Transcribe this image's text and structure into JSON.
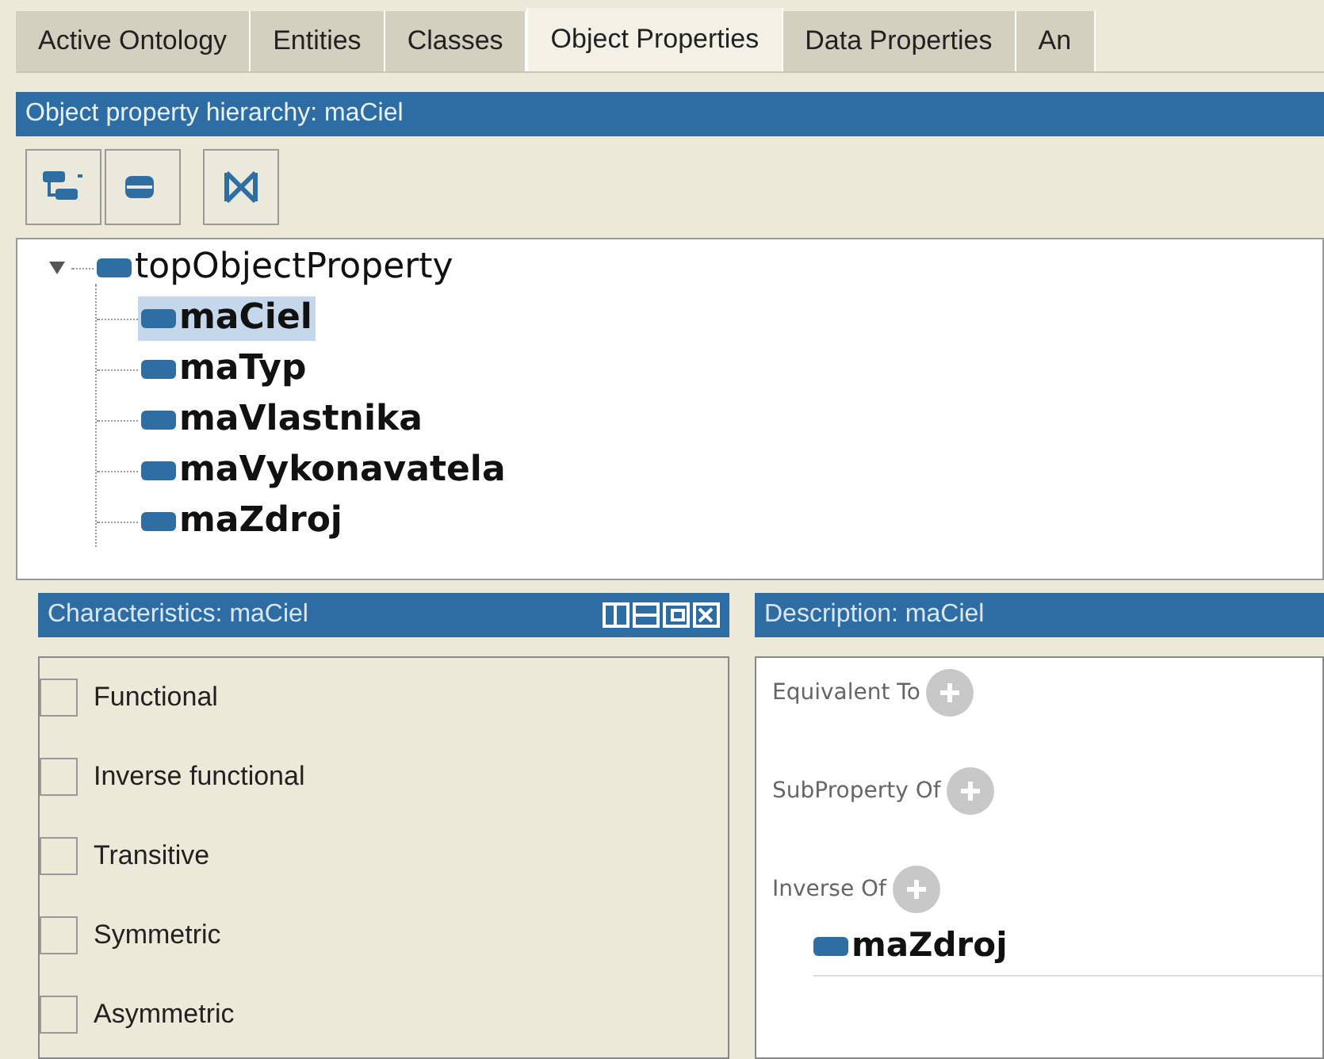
{
  "tabs": [
    {
      "label": "Active Ontology",
      "selected": false
    },
    {
      "label": "Entities",
      "selected": false
    },
    {
      "label": "Classes",
      "selected": false
    },
    {
      "label": "Object Properties",
      "selected": true
    },
    {
      "label": "Data Properties",
      "selected": false
    },
    {
      "label": "An",
      "selected": false
    }
  ],
  "hierarchy": {
    "title": "Object property hierarchy: maCiel",
    "tree": [
      {
        "label": "topObjectProperty",
        "expanded": true,
        "selected": false,
        "children": [
          {
            "label": "maCiel",
            "selected": true
          },
          {
            "label": "maTyp",
            "selected": false
          },
          {
            "label": "maVlastnika",
            "selected": false
          },
          {
            "label": "maVykonavatela",
            "selected": false
          },
          {
            "label": "maZdroj",
            "selected": false
          }
        ]
      }
    ]
  },
  "characteristics": {
    "title": "Characteristics: maCiel",
    "items": [
      {
        "label": "Functional",
        "checked": false
      },
      {
        "label": "Inverse functional",
        "checked": false
      },
      {
        "label": "Transitive",
        "checked": false
      },
      {
        "label": "Symmetric",
        "checked": false
      },
      {
        "label": "Asymmetric",
        "checked": false
      }
    ]
  },
  "description": {
    "title": "Description: maCiel",
    "sections": [
      {
        "label": "Equivalent To"
      },
      {
        "label": "SubProperty Of"
      },
      {
        "label": "Inverse Of",
        "entries": [
          "maZdroj"
        ]
      }
    ]
  }
}
